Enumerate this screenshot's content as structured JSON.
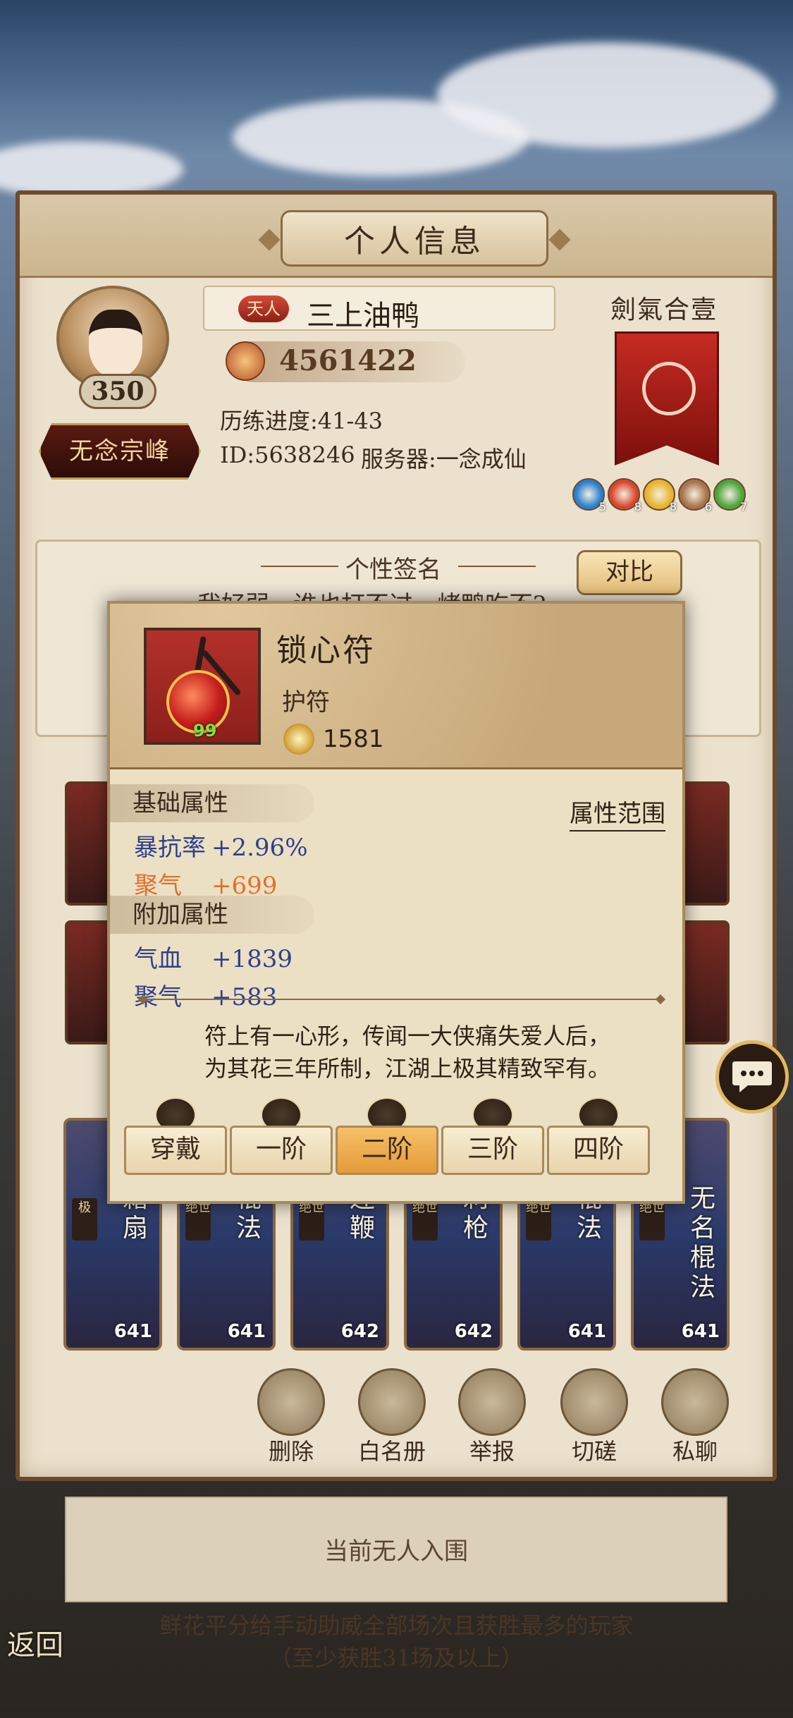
{
  "header": {
    "title": "个人信息"
  },
  "profile": {
    "level": "350",
    "rank_badge": "天人",
    "name": "三上油鸭",
    "power": "4561422",
    "progress": "历练进度:41-43",
    "id_line": "ID:5638246",
    "server": "服务器:一念成仙",
    "sect": "无念宗峰",
    "banner_label": "劍氣合壹",
    "orbs": [
      {
        "count": "5",
        "color": "#2a7fcf"
      },
      {
        "count": "8",
        "color": "#d8462a"
      },
      {
        "count": "8",
        "color": "#e8b22a"
      },
      {
        "count": "6",
        "color": "#a8734a"
      },
      {
        "count": "7",
        "color": "#4ea43a"
      }
    ]
  },
  "signature": {
    "title": "个性签名",
    "text": "我好弱，谁也打不过，烤鸭吃不?",
    "compare_button": "对比"
  },
  "cards": [
    {
      "title": "霜扇",
      "tag": "极",
      "num": "641"
    },
    {
      "title": "棍法",
      "tag": "绝世",
      "num": "641"
    },
    {
      "title": "连鞭",
      "tag": "绝世",
      "num": "642"
    },
    {
      "title": "刺枪",
      "tag": "绝世",
      "num": "642"
    },
    {
      "title": "棍法",
      "tag": "绝世",
      "num": "641"
    },
    {
      "title": "无名棍法",
      "tag": "绝世",
      "num": "641"
    }
  ],
  "actions": [
    {
      "label": "删除",
      "icon": "delete-icon"
    },
    {
      "label": "白名册",
      "icon": "whitelist-book-icon"
    },
    {
      "label": "举报",
      "icon": "report-icon"
    },
    {
      "label": "切磋",
      "icon": "duel-icon"
    },
    {
      "label": "私聊",
      "icon": "chat-icon"
    }
  ],
  "bottom": {
    "empty_text": "当前无人入围",
    "rule_text": "鲜花平分给手动助威全部场次且获胜最多的玩家（至少获胜31场及以上）",
    "back_label": "返回"
  },
  "popup": {
    "item_name": "锁心符",
    "item_type": "护符",
    "item_level": "99",
    "score": "1581",
    "base_title": "基础属性",
    "range_link": "属性范围",
    "base_stats": [
      {
        "name": "暴抗率",
        "value": "+2.96%",
        "color": "blue"
      },
      {
        "name": "聚气",
        "value": "+699",
        "color": "orange"
      }
    ],
    "extra_title": "附加属性",
    "extra_stats": [
      {
        "name": "气血",
        "value": "+1839"
      },
      {
        "name": "聚气",
        "value": "+583"
      }
    ],
    "description_1": "符上有一心形，传闻一大侠痛失爱人后，",
    "description_2": "为其花三年所制，江湖上极其精致罕有。",
    "tiers": [
      {
        "label": "穿戴",
        "active": false
      },
      {
        "label": "一阶",
        "active": false
      },
      {
        "label": "二阶",
        "active": true
      },
      {
        "label": "三阶",
        "active": false
      },
      {
        "label": "四阶",
        "active": false
      }
    ]
  }
}
